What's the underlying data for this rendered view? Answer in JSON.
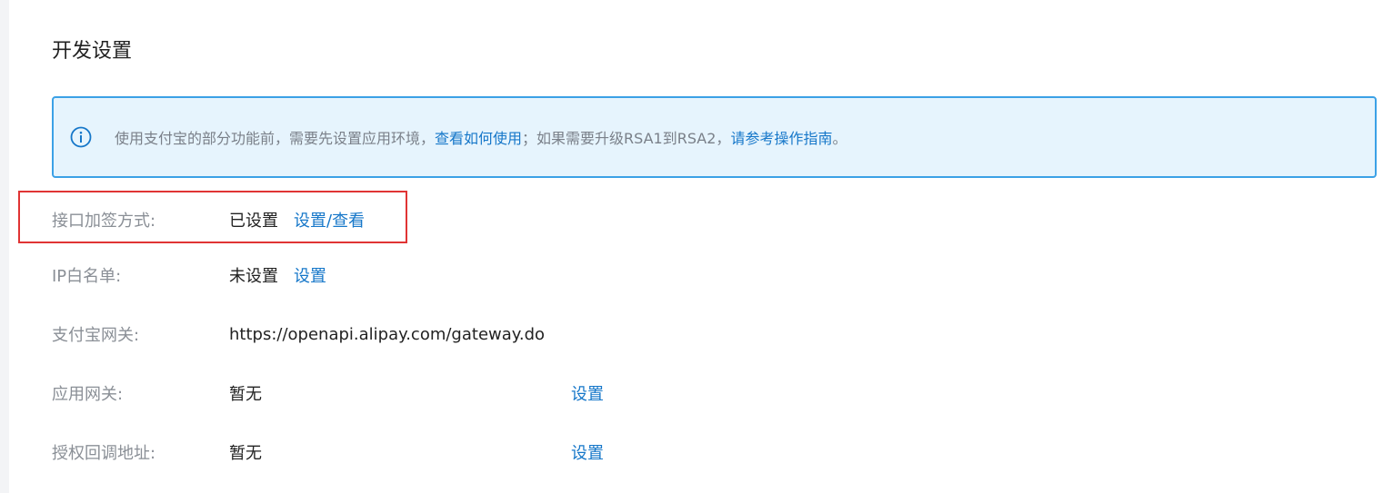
{
  "page_title": "开发设置",
  "notice": {
    "text_before": "使用支付宝的部分功能前，需要先设置应用环境，",
    "link_usage": "查看如何使用",
    "text_middle": "；如果需要升级RSA1到RSA2，",
    "link_guide": "请参考操作指南",
    "text_after": "。"
  },
  "rows": {
    "sign": {
      "label": "接口加签方式:",
      "value": "已设置",
      "action": "设置/查看"
    },
    "ip": {
      "label": "IP白名单:",
      "value": "未设置",
      "action": "设置"
    },
    "gateway": {
      "label": "支付宝网关:",
      "value": "https://openapi.alipay.com/gateway.do"
    },
    "app_gateway": {
      "label": "应用网关:",
      "value": "暂无",
      "action": "设置"
    },
    "callback": {
      "label": "授权回调地址:",
      "value": "暂无",
      "action": "设置"
    }
  },
  "colors": {
    "link": "#1677c9",
    "notice_border": "#3ba1e6",
    "notice_bg": "#e6f4fd",
    "highlight": "#e03434"
  },
  "icons": {
    "notice_icon": "info-circle-icon"
  }
}
